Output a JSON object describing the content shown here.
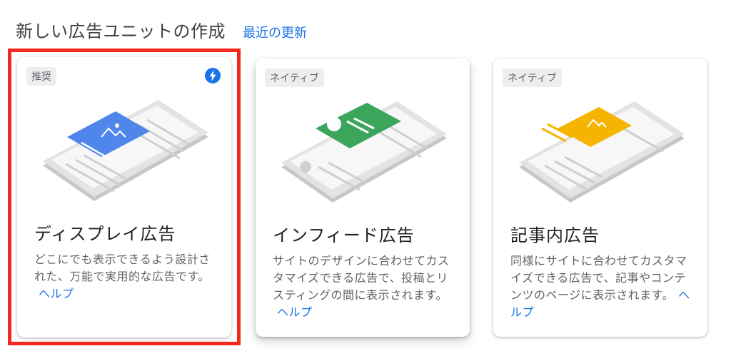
{
  "header": {
    "title": "新しい広告ユニットの作成",
    "recent_link": "最近の更新"
  },
  "colors": {
    "accent": "#1a73e8",
    "highlight": "#f4281c",
    "display": "#4f86ec",
    "infeed": "#3ba55c",
    "inarticle": "#f4b400"
  },
  "cards": [
    {
      "tag": "推奨",
      "icon": "lightning-bolt-icon",
      "title": "ディスプレイ広告",
      "description": "どこにでも表示できるよう設計された、万能で実用的な広告です。",
      "help": "ヘルプ"
    },
    {
      "tag": "ネイティブ",
      "title": "インフィード広告",
      "description": "サイトのデザインに合わせてカスタマイズできる広告で、投稿とリスティングの間に表示されます。",
      "help": "ヘルプ"
    },
    {
      "tag": "ネイティブ",
      "title": "記事内広告",
      "description": "同様にサイトに合わせてカスタマイズできる広告で、記事やコンテンツのページに表示されます。",
      "help": "ヘルプ"
    }
  ]
}
